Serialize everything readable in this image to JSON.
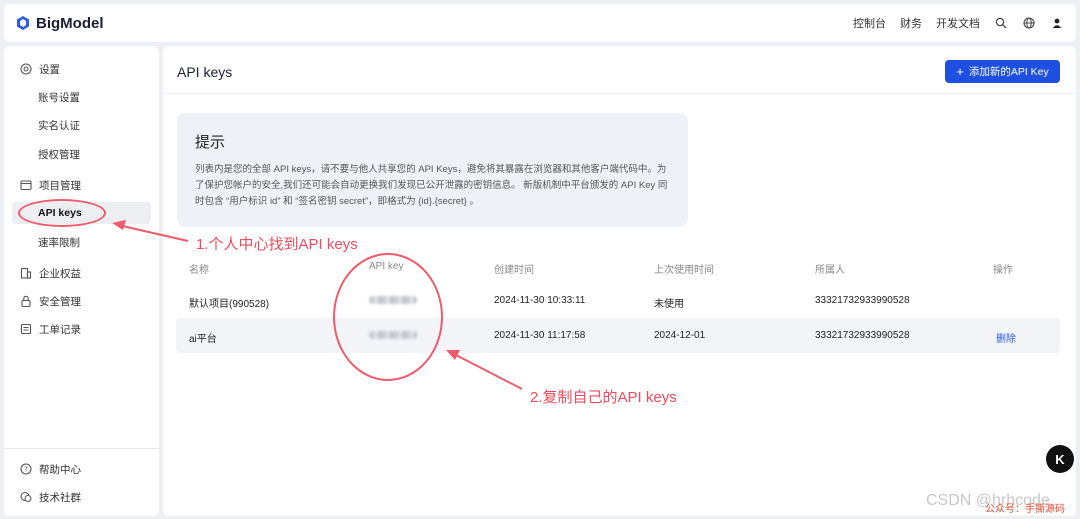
{
  "topbar": {
    "brand": "BigModel",
    "nav": [
      "控制台",
      "财务",
      "开发文档"
    ],
    "icons": [
      "search-icon",
      "globe-icon",
      "user-icon"
    ]
  },
  "sidebar": {
    "items": [
      {
        "label": "设置",
        "icon": "gear-icon",
        "type": "group"
      },
      {
        "label": "账号设置",
        "type": "sub"
      },
      {
        "label": "实名认证",
        "type": "sub"
      },
      {
        "label": "授权管理",
        "type": "sub"
      },
      {
        "label": "项目管理",
        "icon": "project-icon",
        "type": "group"
      },
      {
        "label": "API keys",
        "type": "sub",
        "active": true
      },
      {
        "label": "速率限制",
        "type": "sub"
      },
      {
        "label": "企业权益",
        "icon": "building-icon",
        "type": "group"
      },
      {
        "label": "安全管理",
        "icon": "lock-icon",
        "type": "group"
      },
      {
        "label": "工单记录",
        "icon": "ticket-icon",
        "type": "group"
      }
    ],
    "footer": [
      {
        "label": "帮助中心",
        "icon": "help-icon"
      },
      {
        "label": "技术社群",
        "icon": "community-icon"
      }
    ]
  },
  "main": {
    "title": "API keys",
    "add_button": "添加新的API Key",
    "notice": {
      "title": "提示",
      "body": "列表内是您的全部 API keys，请不要与他人共享您的 API Keys，避免将其暴露在浏览器和其他客户端代码中。为了保护您帐户的安全,我们还可能会自动更换我们发现已公开泄露的密钥信息。 新版机制中平台颁发的 API Key 同时包含 “用户标识 id” 和 “签名密钥 secret”，即格式为 {id}.{secret} 。"
    },
    "table": {
      "headers": [
        "名称",
        "API key",
        "创建时间",
        "上次使用时间",
        "所属人",
        "操作"
      ],
      "rows": [
        {
          "name": "默认项目(990528)",
          "api_key": "",
          "created": "2024-11-30 10:33:11",
          "last_used": "未使用",
          "owner": "33321732933990528",
          "action": ""
        },
        {
          "name": "ai平台",
          "api_key": "",
          "created": "2024-11-30 11:17:58",
          "last_used": "2024-12-01",
          "owner": "33321732933990528",
          "action": "删除"
        }
      ]
    }
  },
  "annotations": {
    "step1": "1.个人中心找到API keys",
    "step2": "2.复制自己的API keys",
    "color": "#ef4a5c"
  },
  "floating_button": "K",
  "watermark": "CSDN @hrhcode",
  "watermark2": "公众号：手撕源码",
  "colors": {
    "accent": "#1f4fe0",
    "link": "#2c5be0"
  }
}
